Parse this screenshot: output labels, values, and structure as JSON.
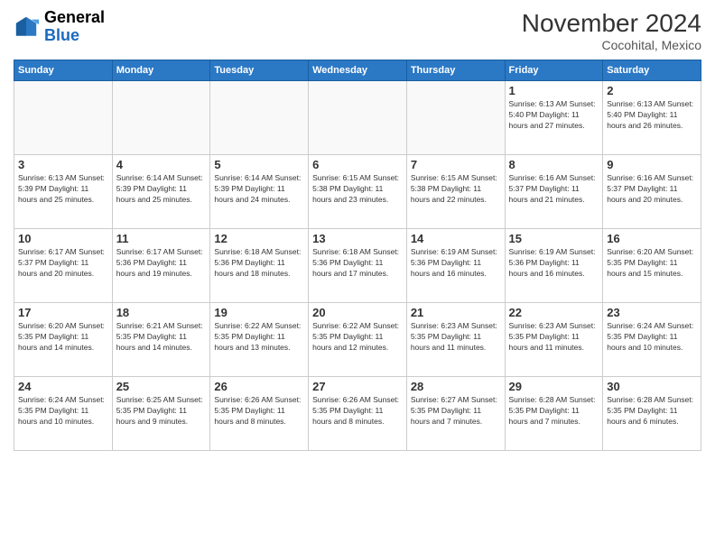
{
  "logo": {
    "general": "General",
    "blue": "Blue"
  },
  "title": "November 2024",
  "location": "Cocohital, Mexico",
  "days_of_week": [
    "Sunday",
    "Monday",
    "Tuesday",
    "Wednesday",
    "Thursday",
    "Friday",
    "Saturday"
  ],
  "weeks": [
    [
      {
        "day": "",
        "info": ""
      },
      {
        "day": "",
        "info": ""
      },
      {
        "day": "",
        "info": ""
      },
      {
        "day": "",
        "info": ""
      },
      {
        "day": "",
        "info": ""
      },
      {
        "day": "1",
        "info": "Sunrise: 6:13 AM\nSunset: 5:40 PM\nDaylight: 11 hours\nand 27 minutes."
      },
      {
        "day": "2",
        "info": "Sunrise: 6:13 AM\nSunset: 5:40 PM\nDaylight: 11 hours\nand 26 minutes."
      }
    ],
    [
      {
        "day": "3",
        "info": "Sunrise: 6:13 AM\nSunset: 5:39 PM\nDaylight: 11 hours\nand 25 minutes."
      },
      {
        "day": "4",
        "info": "Sunrise: 6:14 AM\nSunset: 5:39 PM\nDaylight: 11 hours\nand 25 minutes."
      },
      {
        "day": "5",
        "info": "Sunrise: 6:14 AM\nSunset: 5:39 PM\nDaylight: 11 hours\nand 24 minutes."
      },
      {
        "day": "6",
        "info": "Sunrise: 6:15 AM\nSunset: 5:38 PM\nDaylight: 11 hours\nand 23 minutes."
      },
      {
        "day": "7",
        "info": "Sunrise: 6:15 AM\nSunset: 5:38 PM\nDaylight: 11 hours\nand 22 minutes."
      },
      {
        "day": "8",
        "info": "Sunrise: 6:16 AM\nSunset: 5:37 PM\nDaylight: 11 hours\nand 21 minutes."
      },
      {
        "day": "9",
        "info": "Sunrise: 6:16 AM\nSunset: 5:37 PM\nDaylight: 11 hours\nand 20 minutes."
      }
    ],
    [
      {
        "day": "10",
        "info": "Sunrise: 6:17 AM\nSunset: 5:37 PM\nDaylight: 11 hours\nand 20 minutes."
      },
      {
        "day": "11",
        "info": "Sunrise: 6:17 AM\nSunset: 5:36 PM\nDaylight: 11 hours\nand 19 minutes."
      },
      {
        "day": "12",
        "info": "Sunrise: 6:18 AM\nSunset: 5:36 PM\nDaylight: 11 hours\nand 18 minutes."
      },
      {
        "day": "13",
        "info": "Sunrise: 6:18 AM\nSunset: 5:36 PM\nDaylight: 11 hours\nand 17 minutes."
      },
      {
        "day": "14",
        "info": "Sunrise: 6:19 AM\nSunset: 5:36 PM\nDaylight: 11 hours\nand 16 minutes."
      },
      {
        "day": "15",
        "info": "Sunrise: 6:19 AM\nSunset: 5:36 PM\nDaylight: 11 hours\nand 16 minutes."
      },
      {
        "day": "16",
        "info": "Sunrise: 6:20 AM\nSunset: 5:35 PM\nDaylight: 11 hours\nand 15 minutes."
      }
    ],
    [
      {
        "day": "17",
        "info": "Sunrise: 6:20 AM\nSunset: 5:35 PM\nDaylight: 11 hours\nand 14 minutes."
      },
      {
        "day": "18",
        "info": "Sunrise: 6:21 AM\nSunset: 5:35 PM\nDaylight: 11 hours\nand 14 minutes."
      },
      {
        "day": "19",
        "info": "Sunrise: 6:22 AM\nSunset: 5:35 PM\nDaylight: 11 hours\nand 13 minutes."
      },
      {
        "day": "20",
        "info": "Sunrise: 6:22 AM\nSunset: 5:35 PM\nDaylight: 11 hours\nand 12 minutes."
      },
      {
        "day": "21",
        "info": "Sunrise: 6:23 AM\nSunset: 5:35 PM\nDaylight: 11 hours\nand 11 minutes."
      },
      {
        "day": "22",
        "info": "Sunrise: 6:23 AM\nSunset: 5:35 PM\nDaylight: 11 hours\nand 11 minutes."
      },
      {
        "day": "23",
        "info": "Sunrise: 6:24 AM\nSunset: 5:35 PM\nDaylight: 11 hours\nand 10 minutes."
      }
    ],
    [
      {
        "day": "24",
        "info": "Sunrise: 6:24 AM\nSunset: 5:35 PM\nDaylight: 11 hours\nand 10 minutes."
      },
      {
        "day": "25",
        "info": "Sunrise: 6:25 AM\nSunset: 5:35 PM\nDaylight: 11 hours\nand 9 minutes."
      },
      {
        "day": "26",
        "info": "Sunrise: 6:26 AM\nSunset: 5:35 PM\nDaylight: 11 hours\nand 8 minutes."
      },
      {
        "day": "27",
        "info": "Sunrise: 6:26 AM\nSunset: 5:35 PM\nDaylight: 11 hours\nand 8 minutes."
      },
      {
        "day": "28",
        "info": "Sunrise: 6:27 AM\nSunset: 5:35 PM\nDaylight: 11 hours\nand 7 minutes."
      },
      {
        "day": "29",
        "info": "Sunrise: 6:28 AM\nSunset: 5:35 PM\nDaylight: 11 hours\nand 7 minutes."
      },
      {
        "day": "30",
        "info": "Sunrise: 6:28 AM\nSunset: 5:35 PM\nDaylight: 11 hours\nand 6 minutes."
      }
    ]
  ]
}
